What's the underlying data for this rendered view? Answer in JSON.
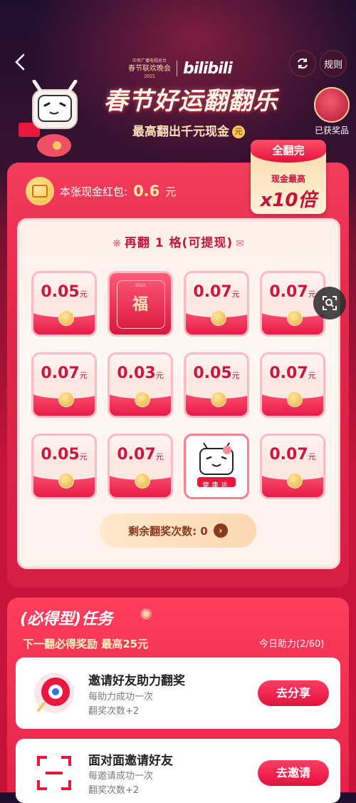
{
  "header": {
    "back_icon": "chevron-left-icon",
    "gala_small": "中央广播电视总台",
    "gala_name": "春节联欢晚会",
    "gala_year": "2025",
    "brand": "bilibili",
    "rules_label": "规则",
    "title": "春节好运翻翻乐",
    "subtitle": "最高翻出千元现金",
    "prizes_label": "已获奖品"
  },
  "cash": {
    "label": "本张现金红包:",
    "value": "0.6",
    "unit": "元"
  },
  "badge": {
    "top": "全翻完",
    "line1": "现金最高",
    "multiplier": "x10倍"
  },
  "board": {
    "title": "再翻 1 格(可提现)",
    "tiles": [
      {
        "type": "amount",
        "value": "0.05",
        "unit": "元"
      },
      {
        "type": "fu",
        "char": "福",
        "year": "2025"
      },
      {
        "type": "amount",
        "value": "0.07",
        "unit": "元"
      },
      {
        "type": "amount",
        "value": "0.07",
        "unit": "元"
      },
      {
        "type": "amount",
        "value": "0.07",
        "unit": "元"
      },
      {
        "type": "amount",
        "value": "0.03",
        "unit": "元"
      },
      {
        "type": "amount",
        "value": "0.05",
        "unit": "元"
      },
      {
        "type": "amount",
        "value": "0.07",
        "unit": "元"
      },
      {
        "type": "amount",
        "value": "0.05",
        "unit": "元"
      },
      {
        "type": "amount",
        "value": "0.07",
        "unit": "元"
      },
      {
        "type": "health",
        "text": "健康运"
      },
      {
        "type": "amount",
        "value": "0.07",
        "unit": "元"
      }
    ],
    "remaining_label": "剩余翻奖次数: 0"
  },
  "tasks": {
    "title": "(必得型)任务",
    "subtitle": "下一翻必得奖励 最高25元",
    "assist": "今日助力(2/60)",
    "items": [
      {
        "name": "邀请好友助力翻奖",
        "desc": "每助力成功一次",
        "bonus": "翻奖次数+2",
        "button": "去分享"
      },
      {
        "name": "面对面邀请好友",
        "desc": "每邀请成功一次",
        "bonus": "翻奖次数+2",
        "button": "去邀请"
      }
    ]
  },
  "colors": {
    "accent_red": "#e3123f",
    "gold": "#f5c867",
    "text_dark_red": "#c9173f"
  }
}
